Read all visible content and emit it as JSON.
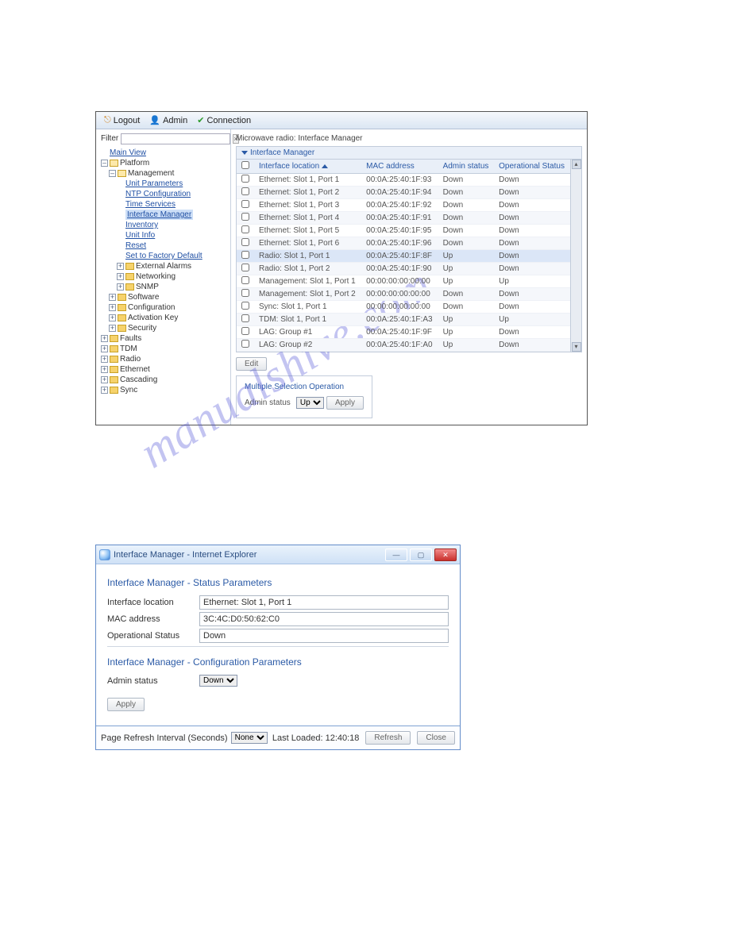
{
  "watermark": "manualshive.com",
  "toolbar": {
    "logout": "Logout",
    "admin": "Admin",
    "connection": "Connection"
  },
  "filter_label": "Filter",
  "filter_value": "",
  "crumb": "Microwave radio: Interface Manager",
  "table": {
    "header_caption": "Interface Manager",
    "col_location": "Interface location",
    "col_mac": "MAC address",
    "col_admin": "Admin status",
    "col_oper": "Operational Status",
    "rows": [
      {
        "loc": "Ethernet: Slot 1, Port 1",
        "mac": "00:0A:25:40:1F:93",
        "admin": "Down",
        "oper": "Down"
      },
      {
        "loc": "Ethernet: Slot 1, Port 2",
        "mac": "00:0A:25:40:1F:94",
        "admin": "Down",
        "oper": "Down"
      },
      {
        "loc": "Ethernet: Slot 1, Port 3",
        "mac": "00:0A:25:40:1F:92",
        "admin": "Down",
        "oper": "Down"
      },
      {
        "loc": "Ethernet: Slot 1, Port 4",
        "mac": "00:0A:25:40:1F:91",
        "admin": "Down",
        "oper": "Down"
      },
      {
        "loc": "Ethernet: Slot 1, Port 5",
        "mac": "00:0A:25:40:1F:95",
        "admin": "Down",
        "oper": "Down"
      },
      {
        "loc": "Ethernet: Slot 1, Port 6",
        "mac": "00:0A:25:40:1F:96",
        "admin": "Down",
        "oper": "Down"
      },
      {
        "loc": "Radio: Slot 1, Port 1",
        "mac": "00:0A:25:40:1F:8F",
        "admin": "Up",
        "oper": "Down",
        "sel": true
      },
      {
        "loc": "Radio: Slot 1, Port 2",
        "mac": "00:0A:25:40:1F:90",
        "admin": "Up",
        "oper": "Down"
      },
      {
        "loc": "Management: Slot 1, Port 1",
        "mac": "00:00:00:00:00:00",
        "admin": "Up",
        "oper": "Up"
      },
      {
        "loc": "Management: Slot 1, Port 2",
        "mac": "00:00:00:00:00:00",
        "admin": "Down",
        "oper": "Down"
      },
      {
        "loc": "Sync: Slot 1, Port 1",
        "mac": "00:00:00:00:00:00",
        "admin": "Down",
        "oper": "Down"
      },
      {
        "loc": "TDM: Slot 1, Port 1",
        "mac": "00:0A:25:40:1F:A3",
        "admin": "Up",
        "oper": "Up"
      },
      {
        "loc": "LAG: Group #1",
        "mac": "00:0A:25:40:1F:9F",
        "admin": "Up",
        "oper": "Down"
      },
      {
        "loc": "LAG: Group #2",
        "mac": "00:0A:25:40:1F:A0",
        "admin": "Up",
        "oper": "Down"
      }
    ]
  },
  "edit_btn": "Edit",
  "mso": {
    "title": "Multiple Selection Operation",
    "label": "Admin status",
    "value": "Up",
    "apply": "Apply"
  },
  "tree": {
    "main_view": "Main View",
    "platform": "Platform",
    "management": "Management",
    "unit_parameters": "Unit Parameters",
    "ntp_config": "NTP Configuration",
    "time_services": "Time Services",
    "interface_manager": "Interface Manager",
    "inventory": "Inventory",
    "unit_info": "Unit Info",
    "reset": "Reset",
    "factory_default": "Set to Factory Default",
    "external_alarms": "External Alarms",
    "networking": "Networking",
    "snmp": "SNMP",
    "software": "Software",
    "configuration": "Configuration",
    "activation_key": "Activation Key",
    "security": "Security",
    "faults": "Faults",
    "tdm": "TDM",
    "radio": "Radio",
    "ethernet": "Ethernet",
    "cascading": "Cascading",
    "sync": "Sync"
  },
  "dialog": {
    "title": "Interface Manager - Internet Explorer",
    "sec_status": "Interface Manager - Status Parameters",
    "sec_config": "Interface Manager - Configuration Parameters",
    "loc_label": "Interface location",
    "loc_val": "Ethernet: Slot 1, Port 1",
    "mac_label": "MAC address",
    "mac_val": "3C:4C:D0:50:62:C0",
    "oper_label": "Operational Status",
    "oper_val": "Down",
    "admin_label": "Admin status",
    "admin_val": "Down",
    "apply": "Apply",
    "refresh_label": "Page Refresh Interval (Seconds)",
    "refresh_val": "None",
    "last_loaded_label": "Last Loaded:",
    "last_loaded_val": "12:40:18",
    "refresh_btn": "Refresh",
    "close_btn": "Close"
  }
}
